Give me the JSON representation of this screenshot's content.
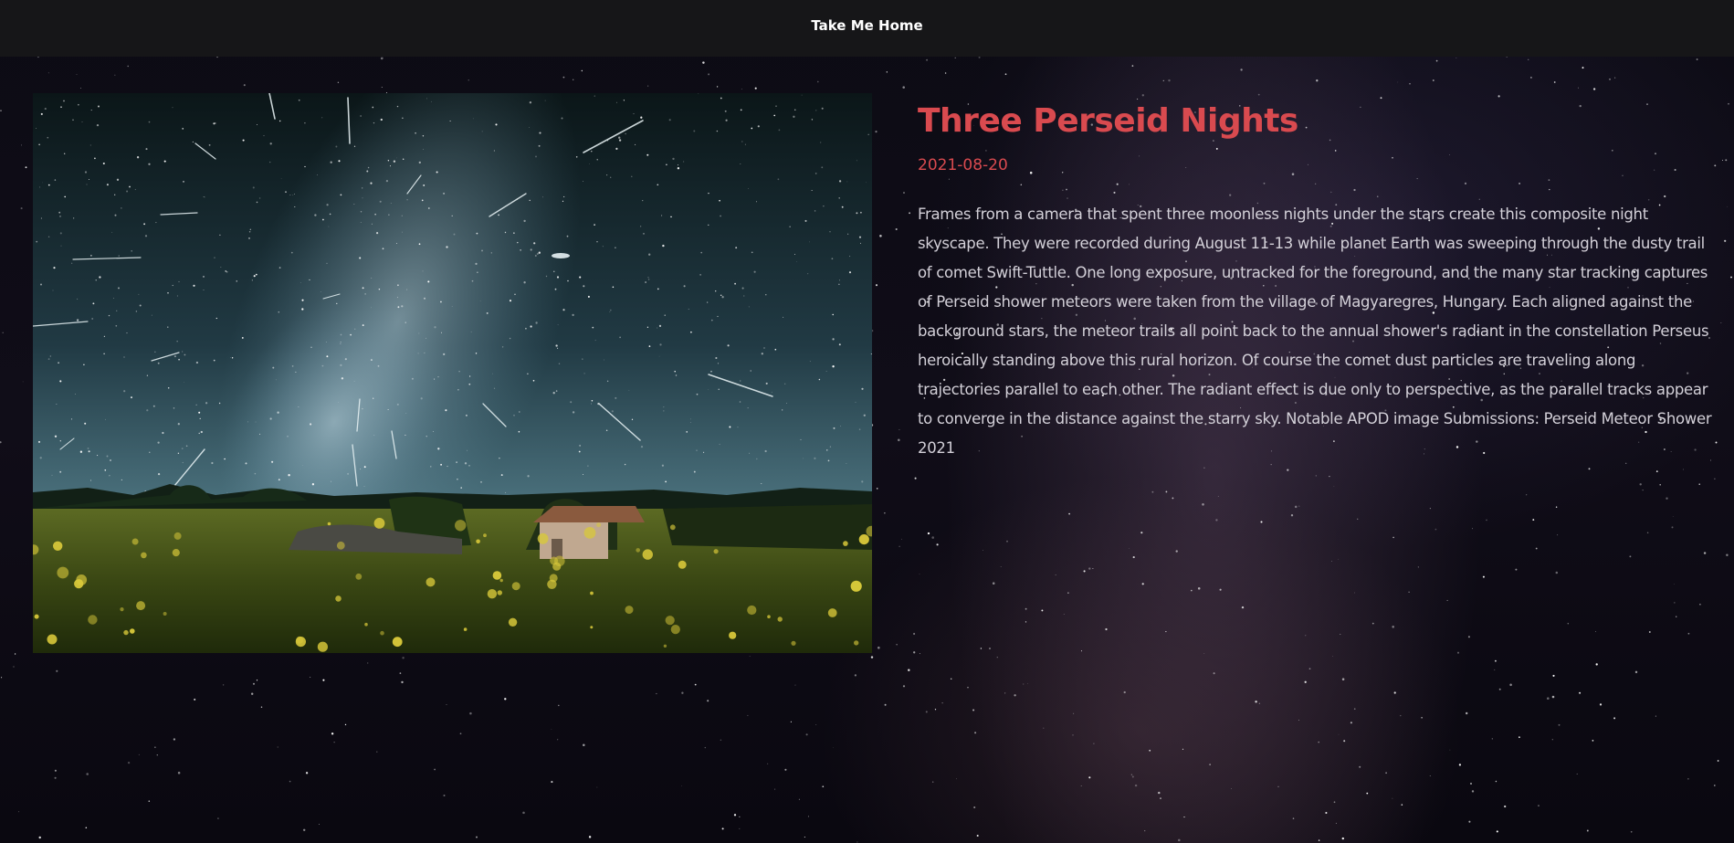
{
  "nav": {
    "home_label": "Take Me Home"
  },
  "apod": {
    "title": "Three Perseid Nights",
    "date": "2021-08-20",
    "explanation": "Frames from a camera that spent three moonless nights under the stars create this composite night skyscape. They were recorded during August 11-13 while planet Earth was sweeping through the dusty trail of comet Swift-Tuttle. One long exposure, untracked for the foreground, and the many star tracking captures of Perseid shower meteors were taken from the village of Magyaregres, Hungary. Each aligned against the background stars, the meteor trails all point back to the annual shower's radiant in the constellation Perseus heroically standing above this rural horizon. Of course the comet dust particles are traveling along trajectories parallel to each other. The radiant effect is due only to perspective, as the parallel tracks appear to converge in the distance against the starry sky. Notable APOD image Submissions: Perseid Meteor Shower 2021"
  },
  "colors": {
    "accent": "#d94a4f",
    "text": "#d3d0d8",
    "topbar": "#161618"
  }
}
